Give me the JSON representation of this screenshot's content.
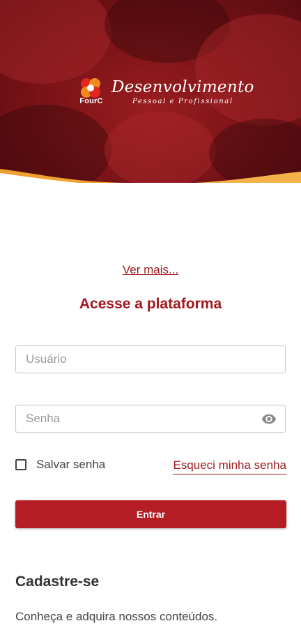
{
  "colors": {
    "accent": "#b41d24",
    "heading": "#a3171d",
    "link": "#9c1c22",
    "hero_orange": "#f0a030"
  },
  "banner": {
    "logo_text": "FourC",
    "title": "Desenvolvimento",
    "subtitle": "Pessoal e Profissional"
  },
  "login": {
    "ver_mais": "Ver mais...",
    "heading": "Acesse a plataforma",
    "username_placeholder": "Usuário",
    "password_placeholder": "Senha",
    "password_toggle_icon": "eye-icon",
    "save_password_label": "Salvar senha",
    "save_password_checked": false,
    "forgot_link": "Esqueci minha senha",
    "submit_label": "Entrar"
  },
  "signup": {
    "title": "Cadastre-se",
    "text": "Conheça e adquira nossos conteúdos."
  }
}
